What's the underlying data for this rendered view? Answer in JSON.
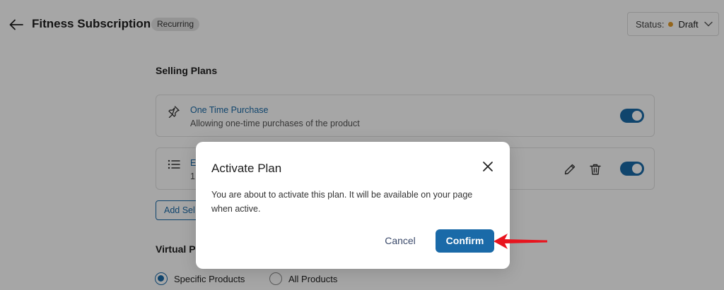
{
  "header": {
    "title": "Fitness Subscription",
    "badge": "Recurring",
    "status_label": "Status:",
    "status_value": "Draft"
  },
  "selling_plans": {
    "title": "Selling Plans",
    "plans": [
      {
        "name": "One Time Purchase",
        "description": "Allowing one-time purchases of the product",
        "enabled": true
      },
      {
        "name": "E",
        "description": "1",
        "enabled": true
      }
    ],
    "add_button_label": "Add Sel"
  },
  "virtual_products": {
    "title": "Virtual P",
    "options": [
      {
        "label": "Specific Products",
        "checked": true
      },
      {
        "label": "All Products",
        "checked": false
      }
    ]
  },
  "modal": {
    "title": "Activate Plan",
    "body": "You are about to activate this plan. It will be available on your page when active.",
    "cancel_label": "Cancel",
    "confirm_label": "Confirm"
  },
  "colors": {
    "accent": "#1a6aa8",
    "status_dot": "#e39b2a",
    "annotation_arrow": "#e8141e"
  },
  "icons": {
    "back": "arrow-left-icon",
    "chevron": "chevron-down-icon",
    "pin": "pin-icon",
    "list": "list-icon",
    "edit": "pencil-icon",
    "delete": "trash-icon",
    "close": "close-icon"
  }
}
